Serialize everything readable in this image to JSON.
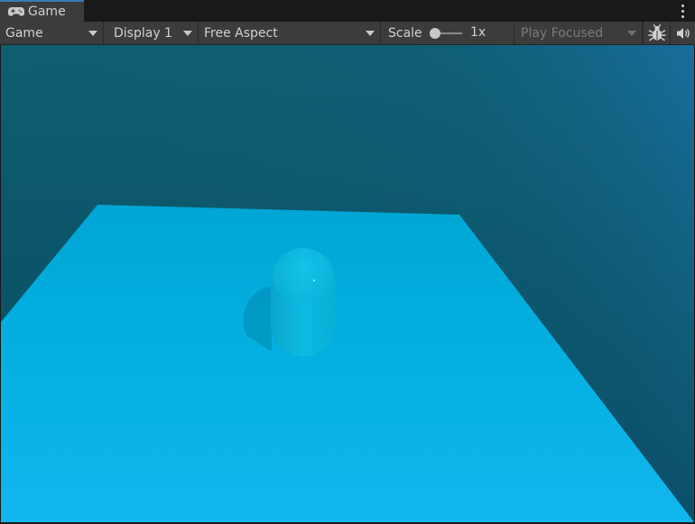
{
  "tab": {
    "title": "Game",
    "icon": "gamepad-icon"
  },
  "toolbar": {
    "view_mode": "Game",
    "display": "Display 1",
    "aspect": "Free Aspect",
    "scale_label": "Scale",
    "scale_value": "1x",
    "play_mode": "Play Focused",
    "stats_icon": "bug-icon",
    "audio_icon": "speaker-icon"
  },
  "colors": {
    "sky_top": "#0f5f70",
    "sky_bottom": "#0a4960",
    "plane": "#04b0e0",
    "capsule": "#08b6dc",
    "tab_accent": "#3a79bb"
  }
}
